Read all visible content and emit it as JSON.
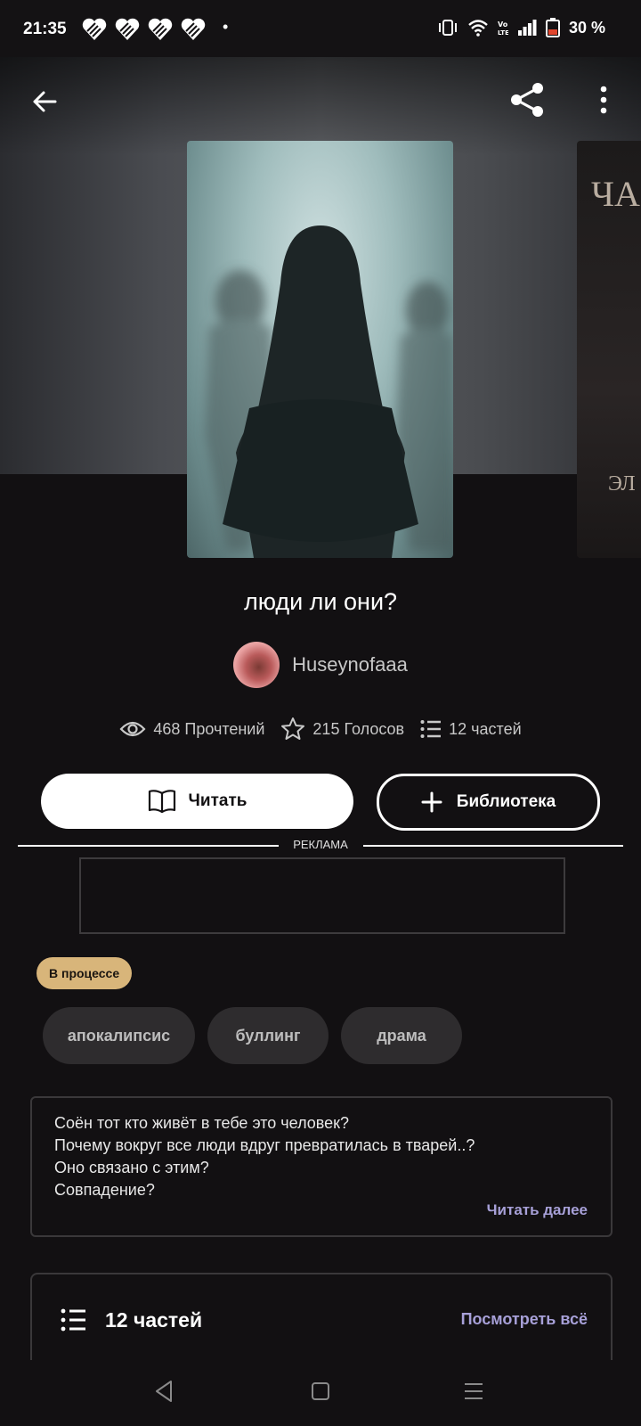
{
  "status_bar": {
    "time": "21:35",
    "battery": "30 %",
    "icons": [
      "heart-icon",
      "heart-icon",
      "heart-icon",
      "heart-icon",
      "vibrate-icon",
      "wifi-icon",
      "volte-icon",
      "signal-icon",
      "battery-icon"
    ]
  },
  "header": {
    "back_icon": "arrow-left-icon",
    "share_icon": "share-icon",
    "more_icon": "more-vertical-icon"
  },
  "next_cover": {
    "text_top": "ЧА",
    "text_bottom": "ЭЛ"
  },
  "story": {
    "title": "люди ли они?",
    "author": "Huseynofaaa",
    "reads": "468 Прочтений",
    "votes": "215 Голосов",
    "parts": "12 частей"
  },
  "actions": {
    "read_label": "Читать",
    "library_label": "Библиотека"
  },
  "ad": {
    "label": "РЕКЛАМА"
  },
  "status_badge": "В процессе",
  "tags": [
    "апокалипсис",
    "буллинг",
    "драма"
  ],
  "description": {
    "lines": [
      "Соён тот кто живёт в тебе это человек?",
      "Почему вокруг все люди вдруг превратилась в тварей..?",
      "Оно связано с этим?",
      "Совпадение?"
    ],
    "read_more": "Читать далее"
  },
  "parts_section": {
    "title": "12 частей",
    "see_all": "Посмотреть всё"
  },
  "colors": {
    "background": "#121012",
    "accent_link": "#a7a0d8",
    "badge": "#d8b57a",
    "tag_bg": "#2e2c2e"
  }
}
